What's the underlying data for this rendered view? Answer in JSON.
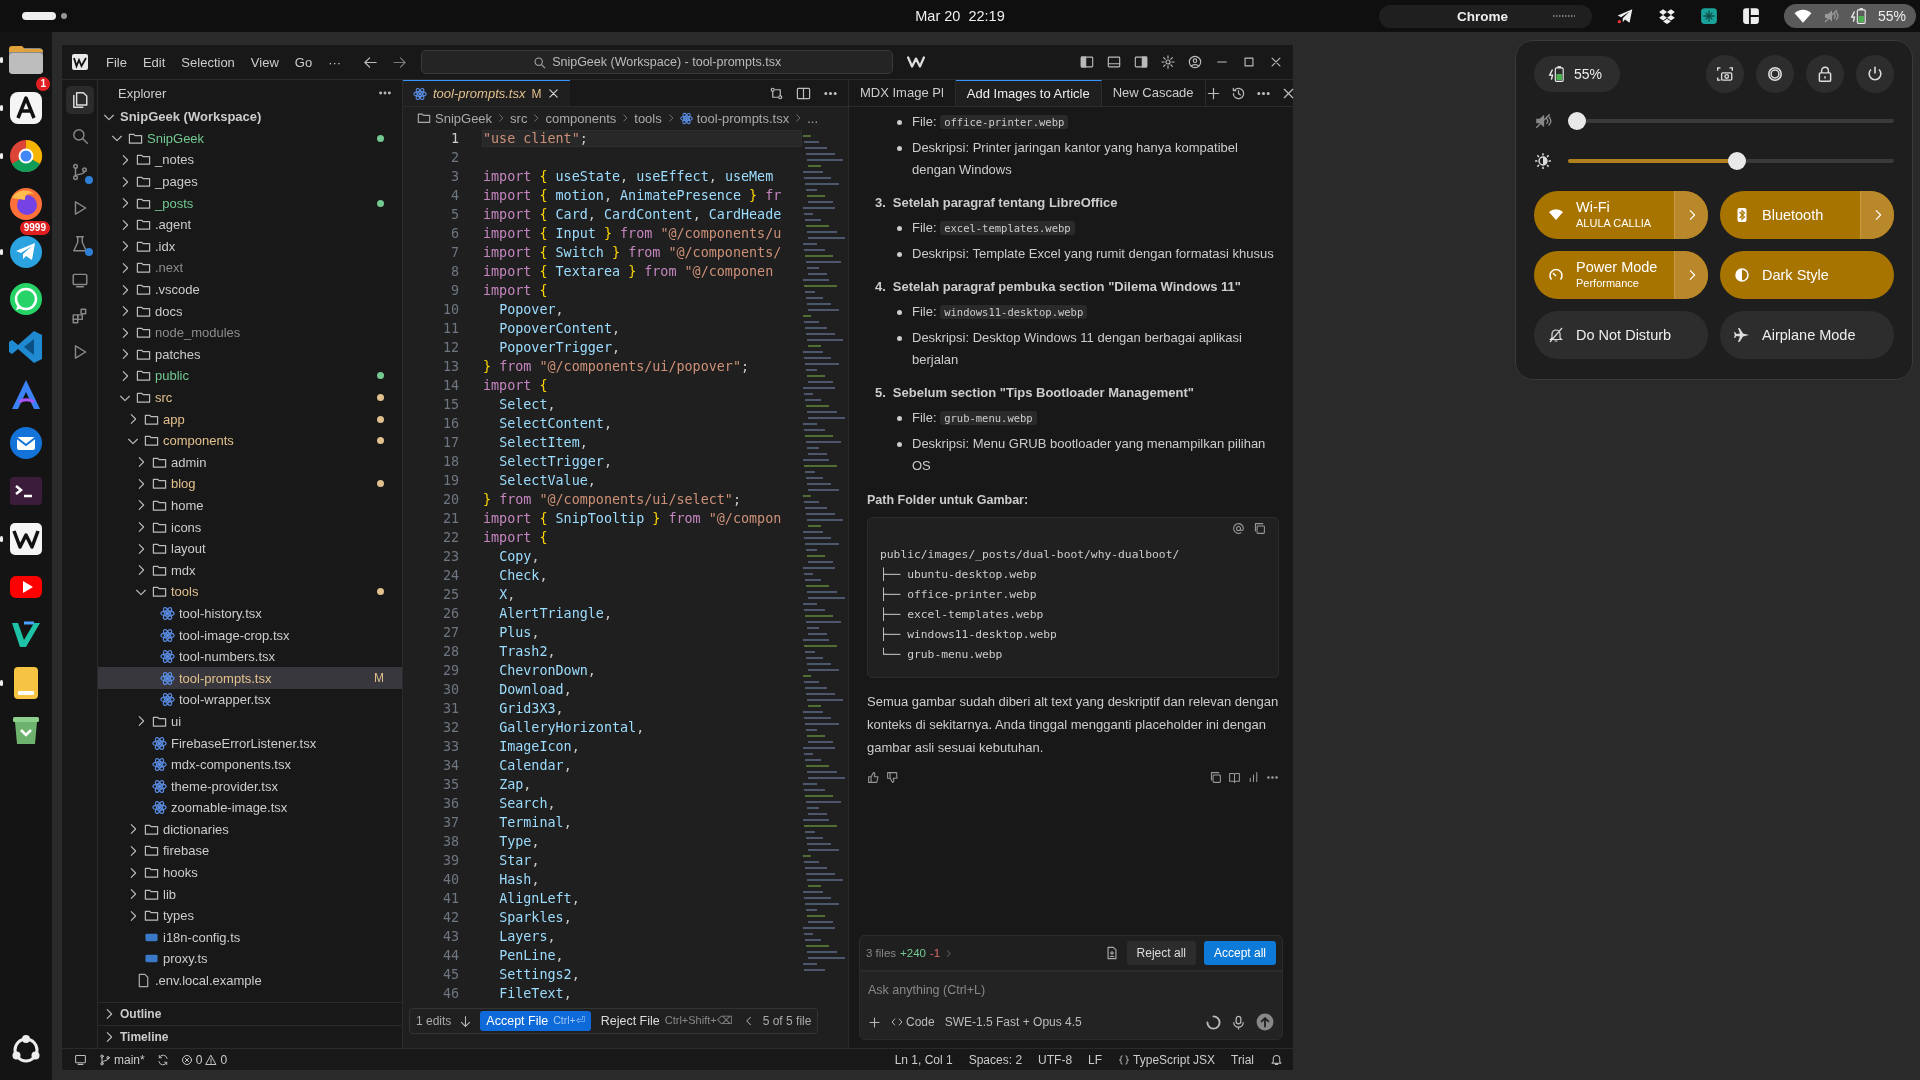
{
  "top_bar": {
    "clock": "Mar 20  22:19",
    "app_menu": "Chrome",
    "battery": "55%",
    "tray": [
      {
        "kind": "plane"
      },
      {
        "kind": "box"
      },
      {
        "kind": "square"
      },
      {
        "kind": "layout"
      }
    ]
  },
  "dock": [
    {
      "kind": "files",
      "running": true
    },
    {
      "kind": "appstore",
      "running": true,
      "badge": "1"
    },
    {
      "kind": "chrome",
      "running": true
    },
    {
      "kind": "firefox",
      "running": false
    },
    {
      "kind": "telegram",
      "running": true,
      "badge": "9999"
    },
    {
      "kind": "whatsapp",
      "running": false
    },
    {
      "kind": "vscode",
      "running": false
    },
    {
      "kind": "arc",
      "running": false
    },
    {
      "kind": "thunderbird",
      "running": false
    },
    {
      "kind": "terminal",
      "running": false
    },
    {
      "kind": "windsurf",
      "running": true
    },
    {
      "kind": "youtube",
      "running": false
    },
    {
      "kind": "codeapp",
      "running": false
    },
    {
      "kind": "notes",
      "running": true
    },
    {
      "kind": "trash",
      "running": false
    },
    {
      "kind": "apps",
      "running": false
    }
  ],
  "editor_window": {
    "menu": [
      "File",
      "Edit",
      "Selection",
      "View",
      "Go",
      "···"
    ],
    "command_center": "SnipGeek (Workspace) - tool-prompts.tsx",
    "explorer": {
      "title": "Explorer",
      "tree": [
        {
          "label": "SnipGeek (Workspace)",
          "kind": "workspace",
          "expanded": true,
          "selected": false,
          "children": [
            {
              "label": "SnipGeek",
              "kind": "folder",
              "expanded": true,
              "color": "#73c991",
              "dot": true,
              "selected": false,
              "children": [
                {
                  "label": "_notes",
                  "kind": "folder",
                  "expanded": false,
                  "selected": false
                },
                {
                  "label": "_pages",
                  "kind": "folder",
                  "expanded": false,
                  "selected": false
                },
                {
                  "label": "_posts",
                  "kind": "folder",
                  "expanded": false,
                  "color": "#73c991",
                  "dot": true,
                  "selected": false
                },
                {
                  "label": ".agent",
                  "kind": "folder",
                  "expanded": false,
                  "selected": false
                },
                {
                  "label": ".idx",
                  "kind": "folder",
                  "expanded": false,
                  "selected": false
                },
                {
                  "label": ".next",
                  "kind": "folder",
                  "expanded": false,
                  "color": "#8c8c8c",
                  "dot": false,
                  "selected": false
                },
                {
                  "label": ".vscode",
                  "kind": "folder",
                  "expanded": false,
                  "selected": false
                },
                {
                  "label": "docs",
                  "kind": "folder",
                  "expanded": false,
                  "selected": false
                },
                {
                  "label": "node_modules",
                  "kind": "folder",
                  "expanded": false,
                  "color": "#8c8c8c",
                  "dot": false,
                  "selected": false
                },
                {
                  "label": "patches",
                  "kind": "folder",
                  "expanded": false,
                  "selected": false
                },
                {
                  "label": "public",
                  "kind": "folder",
                  "expanded": false,
                  "color": "#73c991",
                  "dot": true,
                  "selected": false
                },
                {
                  "label": "src",
                  "kind": "folder",
                  "expanded": true,
                  "color": "#e2c08d",
                  "dot": true,
                  "selected": false,
                  "children": [
                    {
                      "label": "app",
                      "kind": "folder",
                      "expanded": false,
                      "color": "#e2c08d",
                      "dot": true,
                      "selected": false
                    },
                    {
                      "label": "components",
                      "kind": "folder",
                      "expanded": true,
                      "color": "#e2c08d",
                      "dot": true,
                      "selected": false,
                      "children": [
                        {
                          "label": "admin",
                          "kind": "folder",
                          "expanded": false,
                          "selected": false
                        },
                        {
                          "label": "blog",
                          "kind": "folder",
                          "expanded": false,
                          "color": "#e2c08d",
                          "dot": true,
                          "selected": false
                        },
                        {
                          "label": "home",
                          "kind": "folder",
                          "expanded": false,
                          "selected": false
                        },
                        {
                          "label": "icons",
                          "kind": "folder",
                          "expanded": false,
                          "selected": false
                        },
                        {
                          "label": "layout",
                          "kind": "folder",
                          "expanded": false,
                          "selected": false
                        },
                        {
                          "label": "mdx",
                          "kind": "folder",
                          "expanded": false,
                          "selected": false
                        },
                        {
                          "label": "tools",
                          "kind": "folder",
                          "expanded": true,
                          "color": "#e2c08d",
                          "dot": true,
                          "selected": false,
                          "children": [
                            {
                              "label": "tool-history.tsx",
                              "kind": "react",
                              "selected": false
                            },
                            {
                              "label": "tool-image-crop.tsx",
                              "kind": "react",
                              "selected": false
                            },
                            {
                              "label": "tool-numbers.tsx",
                              "kind": "react",
                              "selected": false
                            },
                            {
                              "label": "tool-prompts.tsx",
                              "kind": "react",
                              "color": "#e2c08d",
                              "dot": false,
                              "badge": "M",
                              "selected": true
                            },
                            {
                              "label": "tool-wrapper.tsx",
                              "kind": "react",
                              "selected": false
                            }
                          ]
                        },
                        {
                          "label": "ui",
                          "kind": "folder",
                          "expanded": false,
                          "selected": false
                        },
                        {
                          "label": "FirebaseErrorListener.tsx",
                          "kind": "react",
                          "selected": false
                        },
                        {
                          "label": "mdx-components.tsx",
                          "kind": "react",
                          "selected": false
                        },
                        {
                          "label": "theme-provider.tsx",
                          "kind": "react",
                          "selected": false
                        },
                        {
                          "label": "zoomable-image.tsx",
                          "kind": "react",
                          "selected": false
                        }
                      ]
                    },
                    {
                      "label": "dictionaries",
                      "kind": "folder",
                      "expanded": false,
                      "selected": false
                    },
                    {
                      "label": "firebase",
                      "kind": "folder",
                      "expanded": false,
                      "selected": false
                    },
                    {
                      "label": "hooks",
                      "kind": "folder",
                      "expanded": false,
                      "selected": false
                    },
                    {
                      "label": "lib",
                      "kind": "folder",
                      "expanded": false,
                      "selected": false
                    },
                    {
                      "label": "types",
                      "kind": "folder",
                      "expanded": false,
                      "selected": false
                    },
                    {
                      "label": "i18n-config.ts",
                      "kind": "ts",
                      "selected": false
                    },
                    {
                      "label": "proxy.ts",
                      "kind": "ts",
                      "selected": false
                    }
                  ]
                },
                {
                  "label": ".env.local.example",
                  "kind": "file",
                  "selected": false
                }
              ]
            }
          ]
        }
      ],
      "sections": [
        {
          "label": "Outline",
          "expanded": false
        },
        {
          "label": "Timeline",
          "expanded": false
        }
      ]
    },
    "editor": {
      "tabs": [
        {
          "label": "tool-prompts.tsx",
          "badge": "M",
          "selected": true
        }
      ],
      "breadcrumbs": [
        "SnipGeek",
        "src",
        "components",
        "tools",
        "tool-prompts.tsx",
        "..."
      ],
      "lines": [
        {
          "n": "1",
          "current": true,
          "text": "\"use client\";"
        },
        {
          "n": "2",
          "current": false
        },
        {
          "n": "3",
          "current": false,
          "text": "import { useState, useEffect, useMem"
        },
        {
          "n": "4",
          "current": false,
          "text": "import { motion, AnimatePresence } fr"
        },
        {
          "n": "5",
          "current": false,
          "text": "import { Card, CardContent, CardHeade"
        },
        {
          "n": "6",
          "current": false,
          "text": "import { Input } from \"@/components/u"
        },
        {
          "n": "7",
          "current": false,
          "text": "import { Switch } from \"@/components/"
        },
        {
          "n": "8",
          "current": false,
          "text": "import { Textarea } from \"@/componen"
        },
        {
          "n": "9",
          "current": false,
          "text": "import {"
        },
        {
          "n": "10",
          "current": false,
          "text": "  Popover,"
        },
        {
          "n": "11",
          "current": false,
          "text": "  PopoverContent,"
        },
        {
          "n": "12",
          "current": false,
          "text": "  PopoverTrigger,"
        },
        {
          "n": "13",
          "current": false,
          "text": "} from \"@/components/ui/popover\";"
        },
        {
          "n": "14",
          "current": false,
          "text": "import {"
        },
        {
          "n": "15",
          "current": false,
          "text": "  Select,"
        },
        {
          "n": "16",
          "current": false,
          "text": "  SelectContent,"
        },
        {
          "n": "17",
          "current": false,
          "text": "  SelectItem,"
        },
        {
          "n": "18",
          "current": false,
          "text": "  SelectTrigger,"
        },
        {
          "n": "19",
          "current": false,
          "text": "  SelectValue,"
        },
        {
          "n": "20",
          "current": false,
          "text": "} from \"@/components/ui/select\";"
        },
        {
          "n": "21",
          "current": false,
          "text": "import { SnipTooltip } from \"@/compon"
        },
        {
          "n": "22",
          "current": false,
          "text": "import {"
        },
        {
          "n": "23",
          "current": false,
          "text": "  Copy,"
        },
        {
          "n": "24",
          "current": false,
          "text": "  Check,"
        },
        {
          "n": "25",
          "current": false,
          "text": "  X,"
        },
        {
          "n": "26",
          "current": false,
          "text": "  AlertTriangle,"
        },
        {
          "n": "27",
          "current": false,
          "text": "  Plus,"
        },
        {
          "n": "28",
          "current": false,
          "text": "  Trash2,"
        },
        {
          "n": "29",
          "current": false,
          "text": "  ChevronDown,"
        },
        {
          "n": "30",
          "current": false,
          "text": "  Download,"
        },
        {
          "n": "31",
          "current": false,
          "text": "  Grid3X3,"
        },
        {
          "n": "32",
          "current": false,
          "text": "  GalleryHorizontal,"
        },
        {
          "n": "33",
          "current": false,
          "text": "  ImageIcon,"
        },
        {
          "n": "34",
          "current": false,
          "text": "  Calendar,"
        },
        {
          "n": "35",
          "current": false,
          "text": "  Zap,"
        },
        {
          "n": "36",
          "current": false,
          "text": "  Search,"
        },
        {
          "n": "37",
          "current": false,
          "text": "  Terminal,"
        },
        {
          "n": "38",
          "current": false,
          "text": "  Type,"
        },
        {
          "n": "39",
          "current": false,
          "text": "  Star,"
        },
        {
          "n": "40",
          "current": false,
          "text": "  Hash,"
        },
        {
          "n": "41",
          "current": false,
          "text": "  AlignLeft,"
        },
        {
          "n": "42",
          "current": false,
          "text": "  Sparkles,"
        },
        {
          "n": "43",
          "current": false,
          "text": "  Layers,"
        },
        {
          "n": "44",
          "current": false,
          "text": "  PenLine,"
        },
        {
          "n": "45",
          "current": false,
          "text": "  Settings2,"
        },
        {
          "n": "46",
          "current": false,
          "text": "  FileText,"
        }
      ],
      "review_bar": {
        "edits": "1 edits",
        "accept": {
          "label": "Accept File",
          "shortcut": "Ctrl+⏎"
        },
        "reject": {
          "label": "Reject File",
          "shortcut": "Ctrl+Shift+⌫"
        },
        "position": "5 of 5 file"
      }
    },
    "chat": {
      "tabs": [
        {
          "label": "MDX Image Pl",
          "selected": false
        },
        {
          "label": "Add Images to Article",
          "selected": true
        },
        {
          "label": "New Cascade",
          "selected": false
        }
      ],
      "blocks": [
        {
          "kind": "bullets",
          "items": [
            {
              "label": "File:",
              "code": "office-printer.webp"
            },
            {
              "text": "Deskripsi: Printer jaringan kantor yang hanya kompatibel dengan Windows"
            }
          ]
        },
        {
          "kind": "step",
          "number": "3.",
          "title": "Setelah paragraf tentang LibreOffice",
          "items": [
            {
              "label": "File:",
              "code": "excel-templates.webp"
            },
            {
              "text": "Deskripsi: Template Excel yang rumit dengan formatasi khusus"
            }
          ]
        },
        {
          "kind": "step",
          "number": "4.",
          "title": "Setelah paragraf pembuka section \"Dilema Windows 11\"",
          "items": [
            {
              "label": "File:",
              "code": "windows11-desktop.webp"
            },
            {
              "text": "Deskripsi: Desktop Windows 11 dengan berbagai aplikasi berjalan"
            }
          ]
        },
        {
          "kind": "step",
          "number": "5.",
          "title": "Sebelum section \"Tips Bootloader Management\"",
          "items": [
            {
              "label": "File:",
              "code": "grub-menu.webp"
            },
            {
              "text": "Deskripsi: Menu GRUB bootloader yang menampilkan pilihan OS"
            }
          ]
        },
        {
          "kind": "heading",
          "text": "Path Folder untuk Gambar:"
        },
        {
          "kind": "code",
          "lines": [
            "public/images/_posts/dual-boot/why-dualboot/",
            "├── ubuntu-desktop.webp",
            "├── office-printer.webp",
            "├── excel-templates.webp",
            "├── windows11-desktop.webp",
            "└── grub-menu.webp"
          ]
        },
        {
          "kind": "paragraph",
          "text": "Semua gambar sudah diberi alt text yang deskriptif dan relevan dengan konteks di sekitarnya. Anda tinggal mengganti placeholder ini dengan gambar asli sesuai kebutuhan."
        }
      ],
      "changes": {
        "files": "3 files",
        "added": "+240",
        "removed": "-1"
      },
      "actions": [
        {
          "label": "Reject all",
          "kind": "secondary"
        },
        {
          "label": "Accept all",
          "kind": "primary"
        }
      ],
      "input": {
        "placeholder": "Ask anything (Ctrl+L)"
      },
      "mode": "Code",
      "model": "SWE-1.5 Fast + Opus 4.5"
    },
    "status_bar": {
      "branch": "main*",
      "errors": "0",
      "warnings": "0",
      "items": [
        "Ln 1, Col 1",
        "Spaces: 2",
        "UTF-8",
        "LF",
        "TypeScript JSX",
        "Trial"
      ]
    }
  },
  "quick_settings": {
    "battery": "55%",
    "volume": {
      "muted": true,
      "level": 0
    },
    "brightness": {
      "level": 0.53
    },
    "toggles": [
      {
        "kind": "wifi",
        "label": "Wi-Fi",
        "subtitle": "ALULA CALLIA",
        "on": true,
        "has_menu": true
      },
      {
        "kind": "bluetooth",
        "label": "Bluetooth",
        "on": true,
        "has_menu": true
      },
      {
        "kind": "power",
        "label": "Power Mode",
        "subtitle": "Performance",
        "on": true,
        "has_menu": true
      },
      {
        "kind": "dark",
        "label": "Dark Style",
        "on": true,
        "has_menu": false
      },
      {
        "kind": "dnd",
        "label": "Do Not Disturb",
        "on": false,
        "has_menu": false
      },
      {
        "kind": "airplane",
        "label": "Airplane Mode",
        "on": false,
        "has_menu": false
      }
    ]
  }
}
